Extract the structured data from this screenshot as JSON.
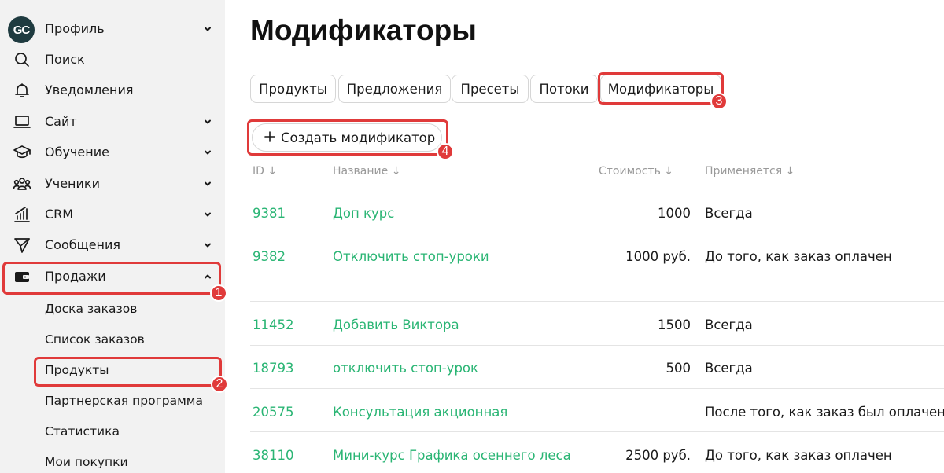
{
  "sidebar": {
    "logo_text": "GC",
    "items": [
      {
        "label": "Профиль",
        "icon": "logo-avatar",
        "has_chevron": true
      },
      {
        "label": "Поиск",
        "icon": "search-icon",
        "has_chevron": false
      },
      {
        "label": "Уведомления",
        "icon": "bell-icon",
        "has_chevron": false
      },
      {
        "label": "Сайт",
        "icon": "laptop-icon",
        "has_chevron": true
      },
      {
        "label": "Обучение",
        "icon": "graduation-cap-icon",
        "has_chevron": true
      },
      {
        "label": "Ученики",
        "icon": "users-icon",
        "has_chevron": true
      },
      {
        "label": "CRM",
        "icon": "chart-icon",
        "has_chevron": true
      },
      {
        "label": "Сообщения",
        "icon": "send-icon",
        "has_chevron": true
      },
      {
        "label": "Продажи",
        "icon": "wallet-icon",
        "has_chevron": true,
        "expanded": true
      }
    ],
    "sales_sub": [
      {
        "label": "Доска заказов"
      },
      {
        "label": "Список заказов"
      },
      {
        "label": "Продукты"
      },
      {
        "label": "Партнерская программа"
      },
      {
        "label": "Статистика"
      },
      {
        "label": "Мои покупки"
      }
    ]
  },
  "main": {
    "title": "Модификаторы",
    "tabs": [
      {
        "label": "Продукты"
      },
      {
        "label": "Предложения"
      },
      {
        "label": "Пресеты"
      },
      {
        "label": "Потоки"
      },
      {
        "label": "Модификаторы",
        "active": true
      }
    ],
    "create_button": "Создать модификатор",
    "table": {
      "headers": [
        "ID ↓",
        "Название ↓",
        "Стоимость ↓",
        "Применяется ↓"
      ],
      "rows": [
        {
          "id": "9381",
          "name": "Доп курс",
          "cost": "1000",
          "applies": "Всегда"
        },
        {
          "id": "9382",
          "name": "Отключить стоп-уроки",
          "cost": "1000 руб.",
          "applies": "До того, как заказ оплачен"
        },
        {
          "id": "11452",
          "name": "Добавить Виктора",
          "cost": "1500",
          "applies": "Всегда"
        },
        {
          "id": "18793",
          "name": "отключить стоп-урок",
          "cost": "500",
          "applies": "Всегда"
        },
        {
          "id": "20575",
          "name": "Консультация акционная",
          "cost": "",
          "applies": "После того, как заказ был оплачен"
        },
        {
          "id": "38110",
          "name": "Мини-курс Графика осеннего леса",
          "cost": "2500 руб.",
          "applies": "До того, как заказ оплачен"
        }
      ]
    }
  },
  "annotations": [
    "1",
    "2",
    "3",
    "4"
  ],
  "colors": {
    "accent_link": "#2ab574",
    "highlight": "#e03a3a",
    "sidebar_bg": "#f2f2f2"
  }
}
